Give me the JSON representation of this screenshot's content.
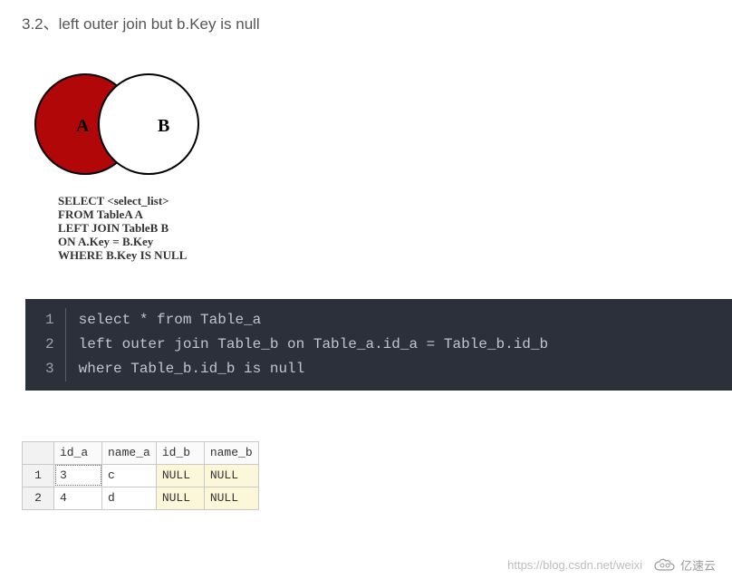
{
  "heading": "3.2、left outer join but b.Key is null",
  "venn": {
    "labelA": "A",
    "labelB": "B"
  },
  "sql_diagram": {
    "l1": "SELECT <select_list>",
    "l2": "FROM TableA A",
    "l3": "LEFT JOIN TableB B",
    "l4": "ON A.Key = B.Key",
    "l5": "WHERE B.Key IS NULL"
  },
  "code": {
    "n1": "1",
    "n2": "2",
    "n3": "3",
    "l1": "select * from Table_a",
    "l2": "left outer join Table_b on Table_a.id_a = Table_b.id_b",
    "l3": "where Table_b.id_b is null"
  },
  "result": {
    "headers": {
      "c1": "id_a",
      "c2": "name_a",
      "c3": "id_b",
      "c4": "name_b"
    },
    "rows": [
      {
        "n": "1",
        "id_a": "3",
        "name_a": "c",
        "id_b": "NULL",
        "name_b": "NULL"
      },
      {
        "n": "2",
        "id_a": "4",
        "name_a": "d",
        "id_b": "NULL",
        "name_b": "NULL"
      }
    ]
  },
  "watermark": {
    "url": "https://blog.csdn.net/weixi",
    "brand": "亿速云"
  }
}
